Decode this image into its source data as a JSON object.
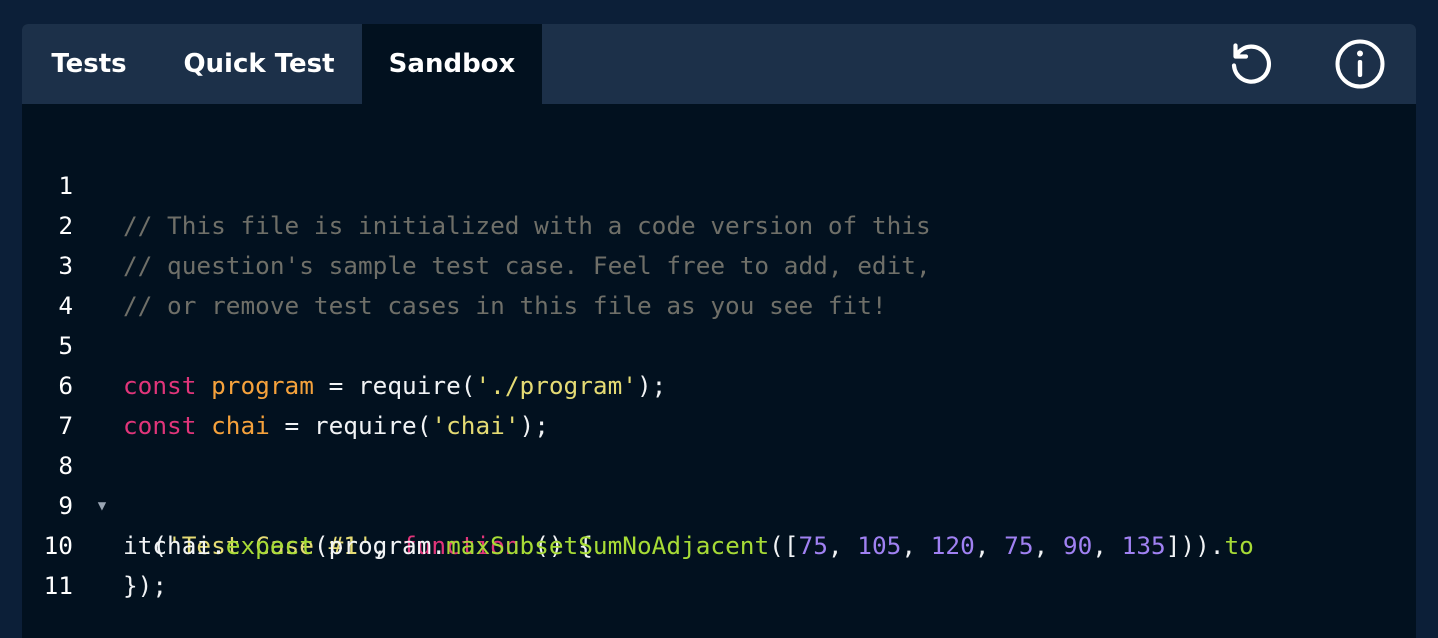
{
  "tabs": {
    "tests": "Tests",
    "quick_test": "Quick Test",
    "sandbox": "Sandbox"
  },
  "icons": {
    "reset": "reset-icon",
    "info": "info-icon"
  },
  "colors": {
    "background": "#0c1f38",
    "tab_bar": "#1c3049",
    "editor": "#02111f",
    "comment": "#6f6f68",
    "keyword": "#e0357a",
    "variable": "#f6a23c",
    "string": "#e5db74",
    "function": "#a7db36",
    "number": "#a081f2"
  },
  "editor": {
    "line_numbers": [
      "1",
      "2",
      "3",
      "4",
      "5",
      "6",
      "7",
      "8",
      "9",
      "10",
      "11"
    ],
    "fold_marker": "▼",
    "line1": "// This file is initialized with a code version of this",
    "line2": "// question's sample test case. Feel free to add, edit,",
    "line3": "// or remove test cases in this file as you see fit!",
    "line5": {
      "kw": "const",
      "name": "program",
      "mid": " = require(",
      "str": "'./program'",
      "end": ");"
    },
    "line6": {
      "kw": "const",
      "name": "chai",
      "mid": " = require(",
      "str": "'chai'",
      "end": ");"
    },
    "line8": {
      "start": "it(",
      "str": "'Test Case #1'",
      "comma": ", ",
      "kw": "function",
      "end": " () {"
    },
    "line9": {
      "indent": "  chai.",
      "fn1": "expect",
      "mid": "(program.",
      "fn2": "maxSubsetSumNoAdjacent",
      "open": "([",
      "n1": "75",
      "n2": "105",
      "n3": "120",
      "n4": "75",
      "n5": "90",
      "n6": "135",
      "sep": ", ",
      "close": "])).",
      "fn3": "to"
    },
    "line10": "});"
  }
}
